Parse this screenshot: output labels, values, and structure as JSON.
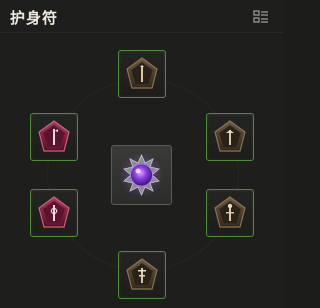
{
  "header": {
    "title": "护身符",
    "menu_icon": "list-menu-icon"
  },
  "center": {
    "icon": "purple-gem-icon",
    "accent": "#7a3fd0"
  },
  "slots": [
    {
      "id": "top",
      "icon": "bronze-rune-pentagon-icon",
      "style": "bronze"
    },
    {
      "id": "left-upper",
      "icon": "crimson-rune-pentagon-icon",
      "style": "crimson"
    },
    {
      "id": "right-upper",
      "icon": "bronze-rune-pentagon-icon",
      "style": "bronze"
    },
    {
      "id": "left-lower",
      "icon": "crimson-rune-pentagon-icon",
      "style": "crimson"
    },
    {
      "id": "right-lower",
      "icon": "bronze-rune-pentagon-icon",
      "style": "bronze"
    },
    {
      "id": "bottom",
      "icon": "bronze-rune-pentagon-icon",
      "style": "bronze"
    }
  ],
  "colors": {
    "slot_border": "#4f8a3c",
    "bronze": "#5a4a36",
    "crimson": "#8a2040"
  }
}
